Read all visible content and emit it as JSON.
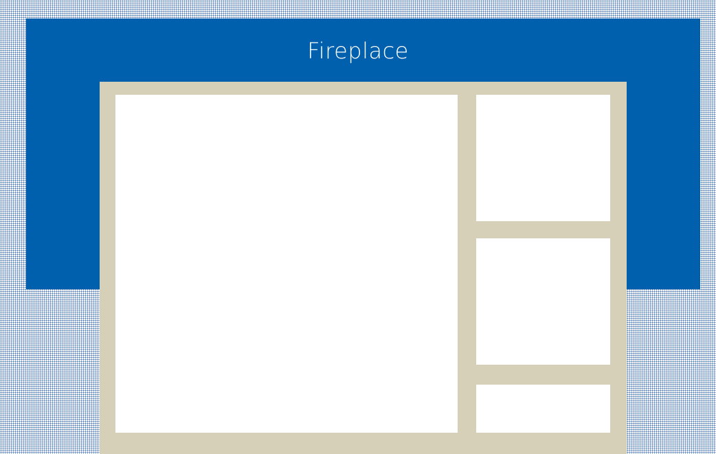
{
  "header": {
    "title": "Fireplace"
  },
  "colors": {
    "header_blue": "#0060ad",
    "frame_beige": "#d6d0b8",
    "pane_white": "#ffffff",
    "dot_pattern": "#3f6fa8"
  }
}
